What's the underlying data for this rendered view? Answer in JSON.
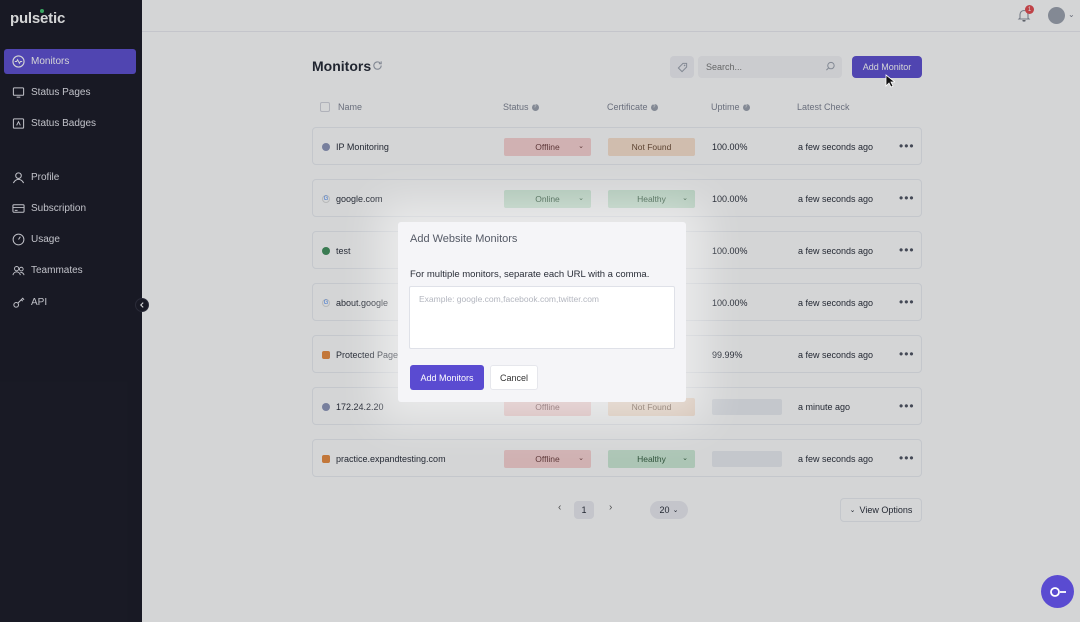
{
  "app": {
    "logo": "pulsetic"
  },
  "sidebar": {
    "items": [
      {
        "label": "Monitors",
        "icon": "monitor-pulse-icon"
      },
      {
        "label": "Status Pages",
        "icon": "screen-icon"
      },
      {
        "label": "Status Badges",
        "icon": "badge-icon"
      },
      {
        "label": "Profile",
        "icon": "user-icon"
      },
      {
        "label": "Subscription",
        "icon": "card-icon"
      },
      {
        "label": "Usage",
        "icon": "gauge-icon"
      },
      {
        "label": "Teammates",
        "icon": "team-icon"
      },
      {
        "label": "API",
        "icon": "key-icon"
      }
    ]
  },
  "topbar": {
    "notification_count": "1"
  },
  "header": {
    "title": "Monitors",
    "search_placeholder": "Search...",
    "add_monitor": "Add Monitor"
  },
  "table": {
    "columns": [
      "Name",
      "Status",
      "Certificate",
      "Uptime",
      "Latest Check"
    ],
    "rows": [
      {
        "name": "IP Monitoring",
        "status": "Offline",
        "cert": "Not Found",
        "uptime": "100.00%",
        "last": "a few seconds ago"
      },
      {
        "name": "google.com",
        "status": "Online",
        "cert": "Healthy",
        "uptime": "100.00%",
        "last": "a few seconds ago"
      },
      {
        "name": "test",
        "status": "",
        "cert": "",
        "uptime": "100.00%",
        "last": "a few seconds ago"
      },
      {
        "name": "about.google",
        "status": "",
        "cert": "",
        "uptime": "100.00%",
        "last": "a few seconds ago"
      },
      {
        "name": "Protected Page",
        "status": "",
        "cert": "",
        "uptime": "99.99%",
        "last": "a few seconds ago"
      },
      {
        "name": "172.24.2.20",
        "status": "Offline",
        "cert": "Not Found",
        "uptime": "",
        "last": "a minute ago"
      },
      {
        "name": "practice.expandtesting.com",
        "status": "Offline",
        "cert": "Healthy",
        "uptime": "",
        "last": "a few seconds ago"
      }
    ]
  },
  "pagination": {
    "prev": "‹",
    "page": "1",
    "next": "›",
    "per_page": "20"
  },
  "view_options": "View Options",
  "modal": {
    "title": "Add Website Monitors",
    "help": "For multiple monitors, separate each URL with a comma.",
    "placeholder": "Example: google.com,facebook.com,twitter.com",
    "submit": "Add Monitors",
    "cancel": "Cancel"
  },
  "colors": {
    "accent": "#5a4bd1",
    "sidebar_bg": "#151521"
  }
}
